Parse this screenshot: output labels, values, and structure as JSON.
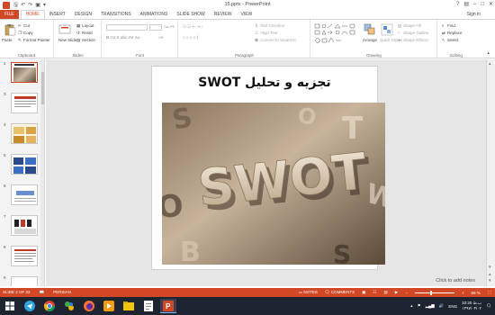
{
  "window": {
    "title": "15.pptx - PowerPoint",
    "sign_in": "Sign in"
  },
  "tabs": [
    "FILE",
    "HOME",
    "INSERT",
    "DESIGN",
    "TRANSITIONS",
    "ANIMATIONS",
    "SLIDE SHOW",
    "REVIEW",
    "VIEW"
  ],
  "ribbon": {
    "clipboard": {
      "paste": "Paste",
      "cut": "Cut",
      "copy": "Copy",
      "format_painter": "Format Painter",
      "label": "Clipboard"
    },
    "slides": {
      "new_slide": "New Slide",
      "layout": "Layout",
      "reset": "Reset",
      "section": "Section",
      "label": "Slides"
    },
    "font": {
      "label": "Font"
    },
    "paragraph": {
      "text_direction": "Text Direction",
      "align_text": "Align Text",
      "convert": "Convert to SmartArt",
      "label": "Paragraph"
    },
    "drawing": {
      "arrange": "Arrange",
      "quick_styles": "Quick Styles",
      "shape_fill": "Shape Fill",
      "shape_outline": "Shape Outline",
      "shape_effects": "Shape Effects",
      "label": "Drawing"
    },
    "editing": {
      "find": "Find",
      "replace": "Replace",
      "select": "Select",
      "label": "Editing"
    }
  },
  "thumbnails": [
    {
      "num": "2",
      "selected": true
    },
    {
      "num": "3",
      "selected": false
    },
    {
      "num": "4",
      "selected": false
    },
    {
      "num": "5",
      "selected": false
    },
    {
      "num": "6",
      "selected": false
    },
    {
      "num": "7",
      "selected": false
    },
    {
      "num": "8",
      "selected": false
    },
    {
      "num": "9",
      "selected": false
    }
  ],
  "slide": {
    "title": "تجزیه و تحلیل SWOT",
    "image_text": "SWOT"
  },
  "notes_hint": "Click to add notes",
  "status": {
    "slide_info": "SLIDE 2 OF 22",
    "language": "PERSIAN",
    "notes": "NOTES",
    "comments": "COMMENTS",
    "zoom": "69 %",
    "zoom_fraction": 0.4
  },
  "taskbar": {
    "lang": "ENG",
    "time": "10:20 ب.ظ",
    "date": "۱۳۹۷/۰۴/۰۲"
  },
  "colors": {
    "accent": "#d24726",
    "taskbar": "#1e2330"
  }
}
